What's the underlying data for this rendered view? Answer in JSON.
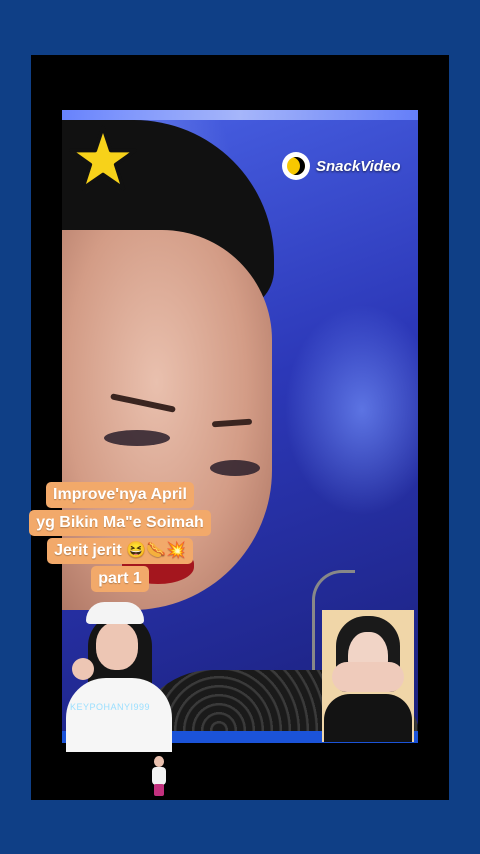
{
  "logo": {
    "name": "SnackVideo"
  },
  "caption": {
    "lines": [
      "Improve'nya April",
      "yg Bikin Ma\"e Soimah",
      "Jerit jerit 😆🌭💥",
      "part 1"
    ]
  },
  "inset_left": {
    "watermark": "KEYPOHANYI999"
  },
  "icons": {
    "star": "star-icon",
    "logo_mark": "snackvideo-logo-icon"
  },
  "colors": {
    "page_bg": "#0f3f86",
    "frame": "#000000",
    "caption_bg": "#f2a96a",
    "star_fill": "#f7d21a"
  }
}
